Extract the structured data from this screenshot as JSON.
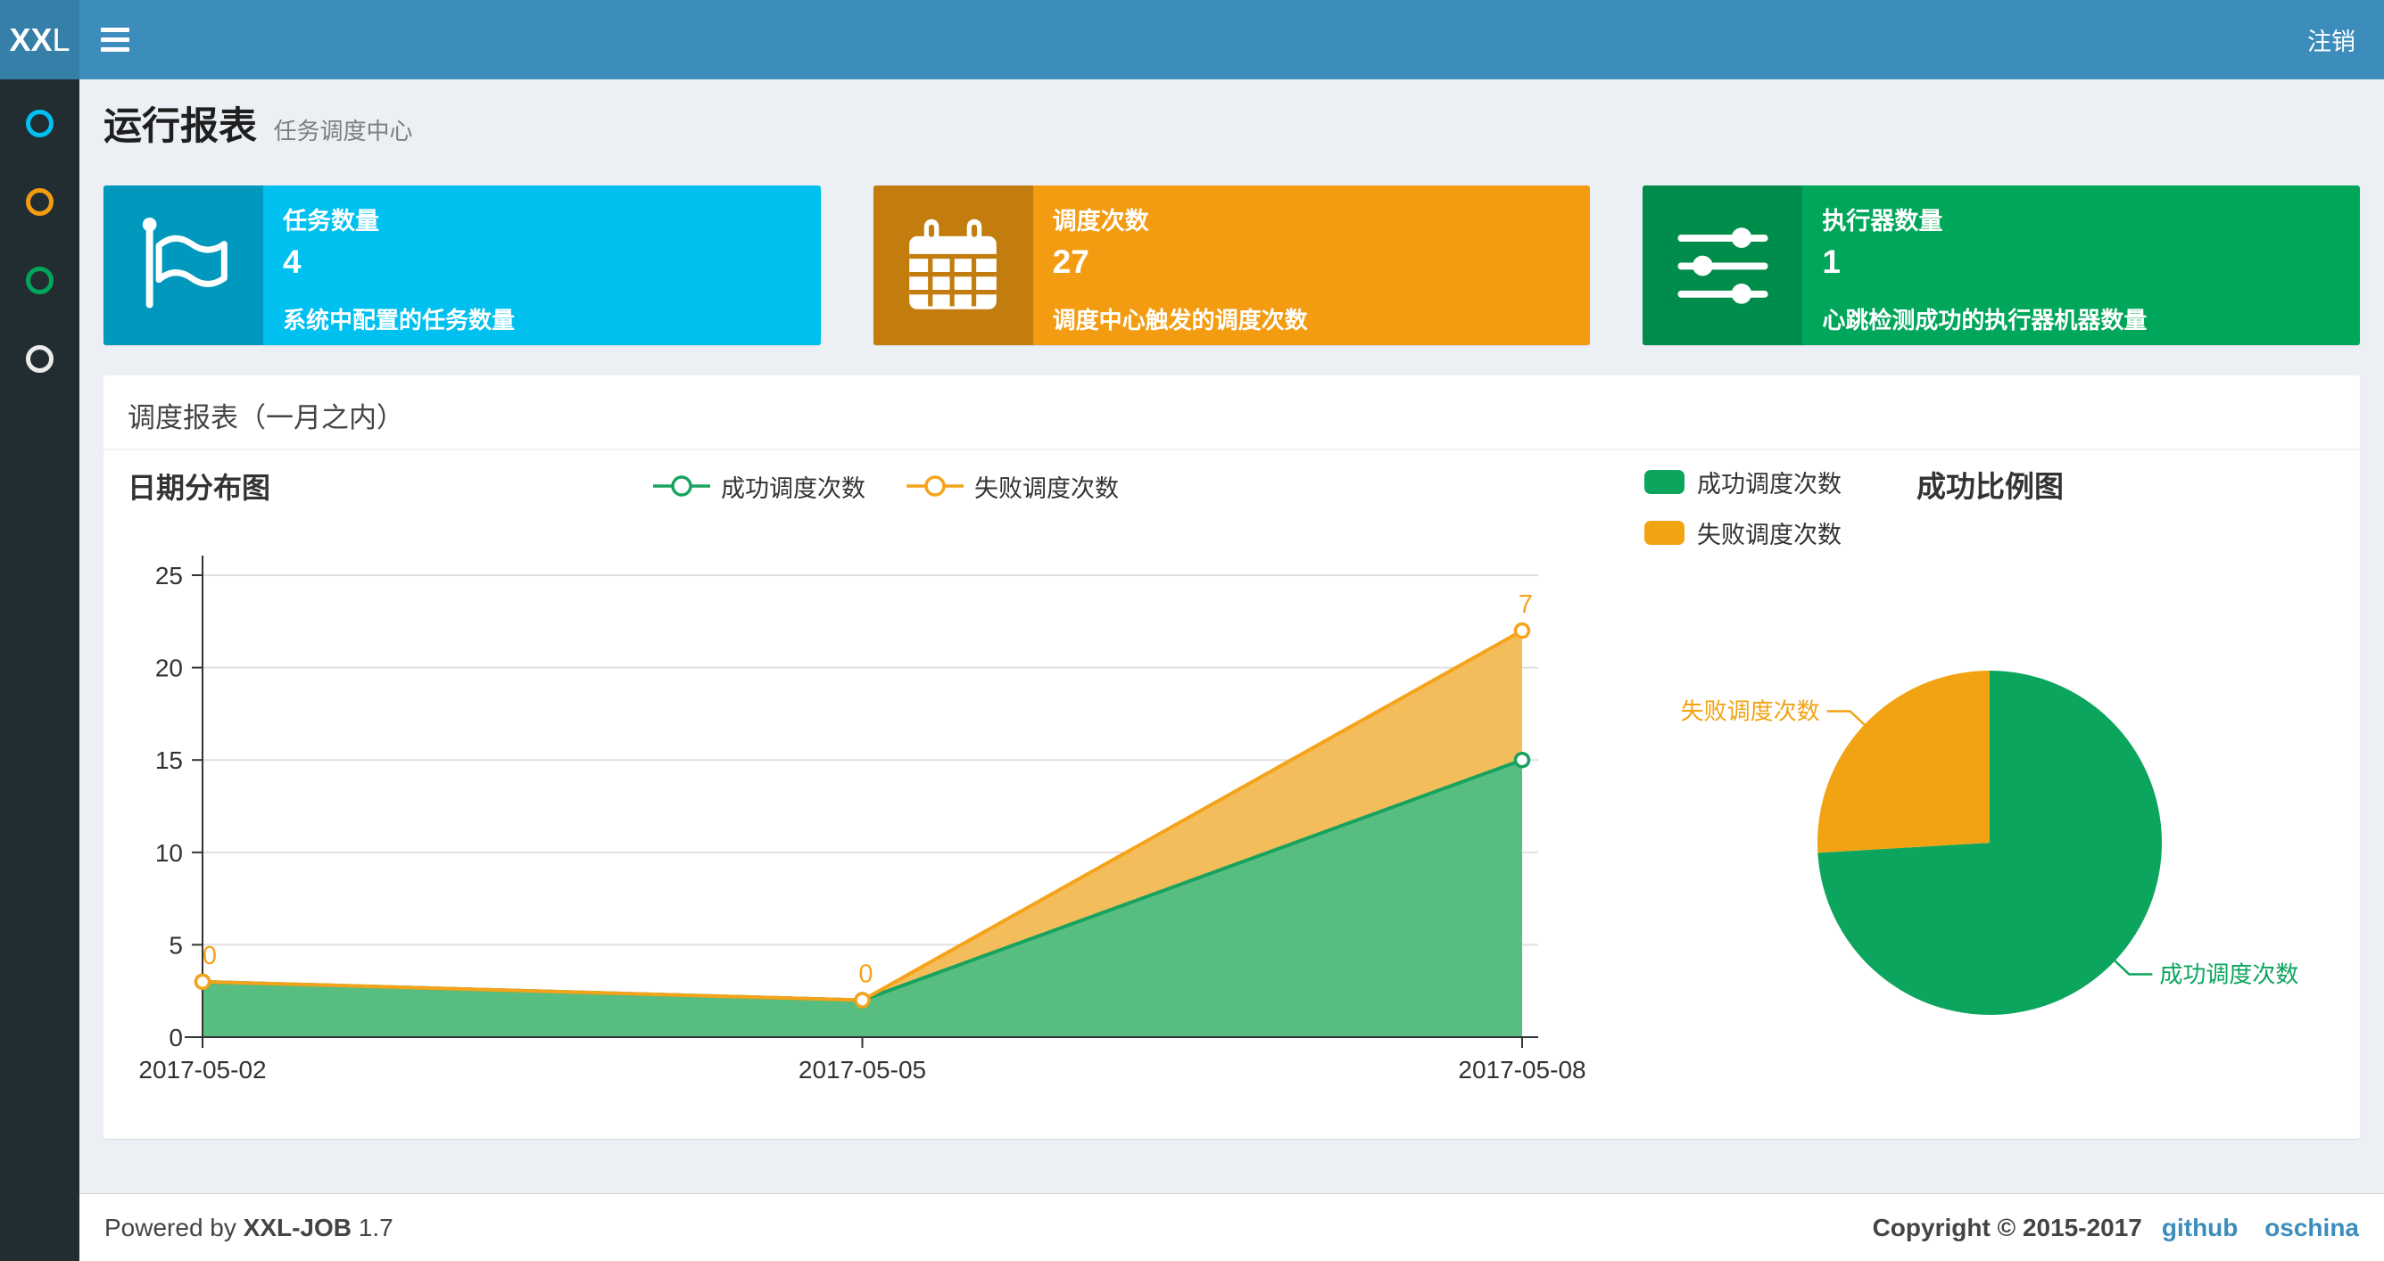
{
  "navbar": {
    "logo_bold": "XX",
    "logo_light": "L",
    "logout_label": "注销",
    "bg_color": "#3c8dbc",
    "logo_bg_color": "#367fa9"
  },
  "sidebar": {
    "bg_color": "#222d32",
    "items": [
      {
        "icon": "circle-outline-icon",
        "color": "#00c0ef"
      },
      {
        "icon": "circle-outline-icon",
        "color": "#f39c12"
      },
      {
        "icon": "circle-outline-icon",
        "color": "#00a65a"
      },
      {
        "icon": "circle-outline-icon",
        "color": "#ececec"
      }
    ]
  },
  "header": {
    "title": "运行报表",
    "subtitle": "任务调度中心"
  },
  "info_boxes": [
    {
      "label": "任务数量",
      "value": "4",
      "description": "系统中配置的任务数量",
      "icon": "flag-icon",
      "bg": "#00c0ef",
      "icon_bg": "#0098bc"
    },
    {
      "label": "调度次数",
      "value": "27",
      "description": "调度中心触发的调度次数",
      "icon": "calendar-icon",
      "bg": "#f39c12",
      "icon_bg": "#c27d0e"
    },
    {
      "label": "执行器数量",
      "value": "1",
      "description": "心跳检测成功的执行器机器数量",
      "icon": "sliders-icon",
      "bg": "#00a65a",
      "icon_bg": "#008d4b"
    }
  ],
  "panel": {
    "title": "调度报表（一月之内）"
  },
  "chart_data": [
    {
      "type": "area",
      "title": "日期分布图",
      "stacked": true,
      "x": [
        "2017-05-02",
        "2017-05-05",
        "2017-05-08"
      ],
      "series": [
        {
          "name": "成功调度次数",
          "values": [
            3,
            2,
            15
          ],
          "line_color": "#17a35f",
          "fill_color": "#58bd81",
          "labels": null
        },
        {
          "name": "失败调度次数",
          "values": [
            0,
            0,
            7
          ],
          "line_color": "#f5a31a",
          "fill_color": "#f4bd5b",
          "labels": [
            "0",
            "0",
            "7"
          ]
        }
      ],
      "ylim": [
        0,
        25
      ],
      "yticks": [
        0,
        5,
        10,
        15,
        20,
        25
      ],
      "grid": true,
      "legend_position": "top-center"
    },
    {
      "type": "pie",
      "title": "成功比例图",
      "slices": [
        {
          "name": "成功调度次数",
          "value": 20,
          "percent": 74.1,
          "color": "#0ca55e"
        },
        {
          "name": "失败调度次数",
          "value": 7,
          "percent": 25.9,
          "color": "#f2a313"
        }
      ],
      "legend_position": "top-left"
    }
  ],
  "footer": {
    "powered_prefix": "Powered by",
    "brand": "XXL-JOB",
    "version": "1.7",
    "copyright": "Copyright © 2015-2017",
    "links": [
      "github",
      "oschina"
    ],
    "link_color": "#3c8dbc"
  }
}
